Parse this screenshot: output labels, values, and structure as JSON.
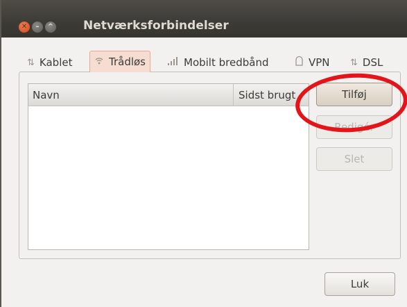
{
  "window": {
    "title": "Netværksforbindelser"
  },
  "tabs": [
    {
      "label": "Kablet",
      "icon": "wired-network-icon",
      "selected": false
    },
    {
      "label": "Trådløs",
      "icon": "wireless-icon",
      "selected": true
    },
    {
      "label": "Mobilt bredbånd",
      "icon": "signal-bars-icon",
      "selected": false
    },
    {
      "label": "VPN",
      "icon": "lock-icon",
      "selected": false
    },
    {
      "label": "DSL",
      "icon": "wired-network-icon",
      "selected": false
    }
  ],
  "list": {
    "columns": [
      "Navn",
      "Sidst brugt"
    ],
    "rows": []
  },
  "buttons": {
    "add": "Tilføj",
    "edit": "Redigér",
    "delete": "Slet",
    "close": "Luk"
  },
  "colors": {
    "titlebar": "#3c3b37",
    "selected_tab": "#f7dcd2",
    "highlight_circle": "#e4141b"
  }
}
